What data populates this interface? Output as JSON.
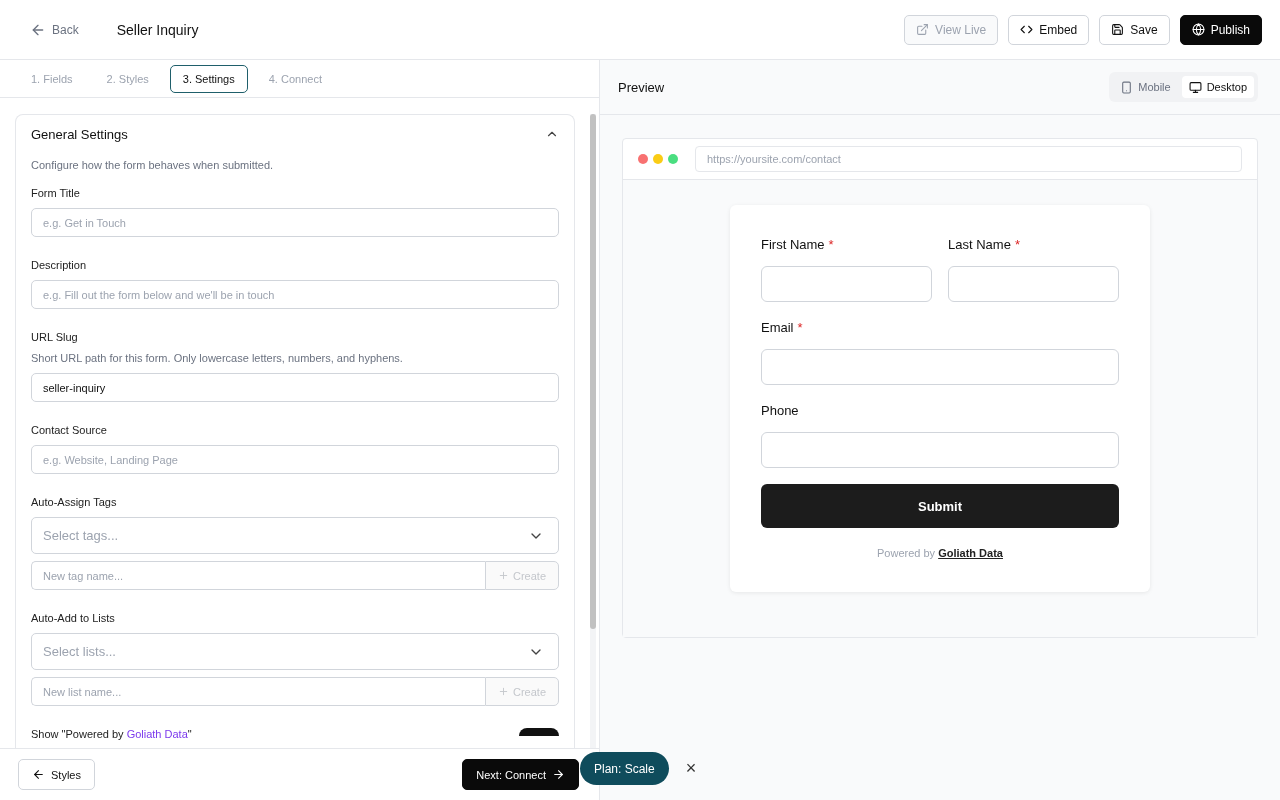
{
  "header": {
    "back": "Back",
    "title": "Seller Inquiry",
    "actions": [
      {
        "label": "View Live",
        "kind": "external",
        "disabled": true,
        "primary": false
      },
      {
        "label": "Embed",
        "kind": "code",
        "disabled": false,
        "primary": false
      },
      {
        "label": "Save",
        "kind": "save",
        "disabled": false,
        "primary": false
      },
      {
        "label": "Publish",
        "kind": "globe",
        "disabled": false,
        "primary": true
      }
    ]
  },
  "tabs": [
    {
      "label": "1. Fields",
      "selected": false
    },
    {
      "label": "2. Styles",
      "selected": false
    },
    {
      "label": "3. Settings",
      "selected": true
    },
    {
      "label": "4. Connect",
      "selected": false
    }
  ],
  "settings": {
    "title": "General Settings",
    "expanded": true,
    "description": "Configure how the form behaves when submitted.",
    "fields": [
      {
        "kind": "text",
        "label": "Form Title",
        "placeholder": "e.g. Get in Touch"
      },
      {
        "kind": "text",
        "label": "Description",
        "placeholder": "e.g. Fill out the form below and we'll be in touch"
      },
      {
        "kind": "text",
        "label": "URL Slug",
        "help": "Short URL path for this form. Only lowercase letters, numbers, and hyphens.",
        "value": "seller-inquiry"
      },
      {
        "kind": "text",
        "label": "Contact Source",
        "placeholder": "e.g. Website, Landing Page"
      },
      {
        "kind": "picker",
        "label": "Auto-Assign Tags",
        "select_placeholder": "Select tags...",
        "new_placeholder": "New tag name...",
        "create": "Create"
      },
      {
        "kind": "picker",
        "label": "Auto-Add to Lists",
        "select_placeholder": "Select lists...",
        "new_placeholder": "New list name...",
        "create": "Create"
      },
      {
        "kind": "toggle",
        "label_before": "Show \"Powered by ",
        "link": "Goliath Data",
        "label_after": "\"",
        "on": true
      }
    ]
  },
  "footer": {
    "back": "Styles",
    "next": "Next: Connect"
  },
  "plan_badge": {
    "label": "Plan: Scale",
    "close": "×"
  },
  "preview": {
    "title": "Preview",
    "modes": [
      {
        "label": "Mobile",
        "kind": "mobile",
        "selected": false
      },
      {
        "label": "Desktop",
        "kind": "desktop",
        "selected": true
      }
    ],
    "url": "https://yoursite.com/contact",
    "form": {
      "rows": [
        [
          {
            "label": "First Name",
            "required_mark": "*"
          },
          {
            "label": "Last Name",
            "required_mark": "*"
          }
        ],
        [
          {
            "label": "Email",
            "required_mark": "*"
          }
        ],
        [
          {
            "label": "Phone"
          }
        ]
      ],
      "submit": "Submit",
      "powered_by": "Powered by",
      "brand": "Goliath Data"
    }
  }
}
